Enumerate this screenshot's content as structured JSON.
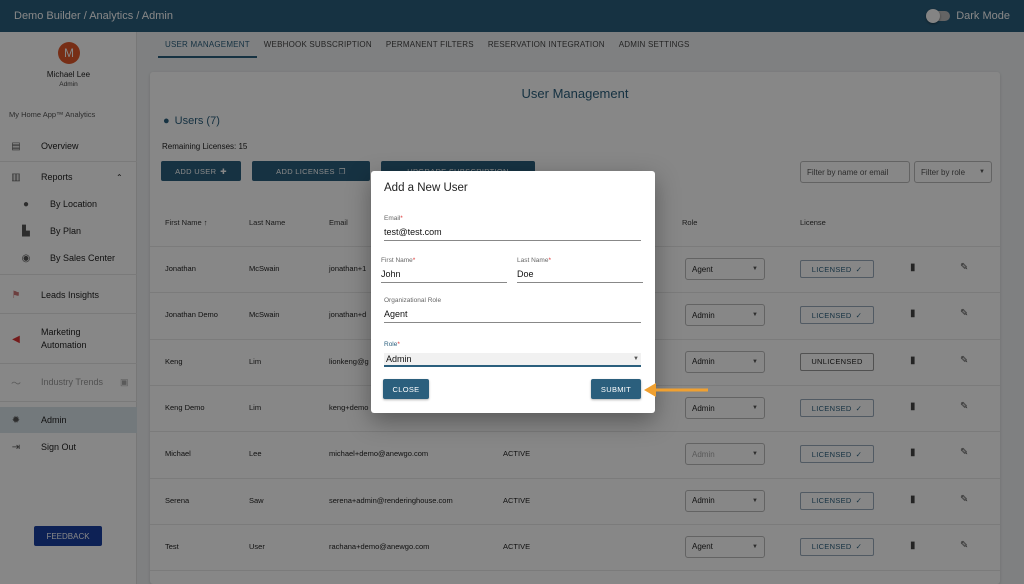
{
  "topbar": {
    "breadcrumb": "Demo Builder  /  Analytics / Admin",
    "dark_mode_label": "Dark Mode"
  },
  "user": {
    "avatar_initial": "M",
    "name": "Michael Lee",
    "role": "Admin"
  },
  "sidebar": {
    "app_name": "My Home App™ Analytics",
    "items": [
      {
        "label": "Overview",
        "icon": "clipboard-icon"
      },
      {
        "label": "Reports",
        "icon": "bar-chart-icon"
      },
      {
        "label": "By Location",
        "icon": "location-pin-icon"
      },
      {
        "label": "By Plan",
        "icon": "building-icon"
      },
      {
        "label": "By Sales Center",
        "icon": "compass-icon"
      },
      {
        "label": "Leads Insights",
        "icon": "chart-people-icon"
      },
      {
        "label": "Marketing\nAutomation",
        "icon": "megaphone-icon"
      },
      {
        "label": "Industry Trends",
        "icon": "trend-icon"
      },
      {
        "label": "Admin",
        "icon": "gear-icon"
      },
      {
        "label": "Sign Out",
        "icon": "exit-icon"
      }
    ],
    "feedback_label": "FEEDBACK"
  },
  "tabs": [
    "USER MANAGEMENT",
    "WEBHOOK SUBSCRIPTION",
    "PERMANENT FILTERS",
    "RESERVATION INTEGRATION",
    "ADMIN SETTINGS"
  ],
  "main": {
    "title": "User Management",
    "users_heading": "Users (7)",
    "remaining": "Remaining Licenses: 15",
    "add_user": "ADD USER",
    "add_licenses": "ADD LICENSES",
    "upgrade": "UPGRADE SUBSCRIPTION",
    "filter_placeholder": "Filter by name or email",
    "filter_role": "Filter by role",
    "columns": [
      "First Name",
      "Last Name",
      "Email",
      "Role",
      "License"
    ],
    "rows": [
      {
        "first": "Jonathan",
        "last": "McSwain",
        "email": "jonathan+1",
        "status": "",
        "role": "Agent",
        "license": "LICENSED"
      },
      {
        "first": "Jonathan Demo",
        "last": "McSwain",
        "email": "jonathan+d",
        "status": "",
        "role": "Admin",
        "license": "LICENSED"
      },
      {
        "first": "Keng",
        "last": "Lim",
        "email": "lionkeng@g",
        "status": "",
        "role": "Admin",
        "license": "UNLICENSED"
      },
      {
        "first": "Keng Demo",
        "last": "Lim",
        "email": "keng+demo",
        "status": "",
        "role": "Admin",
        "license": "LICENSED"
      },
      {
        "first": "Michael",
        "last": "Lee",
        "email": "michael+demo@anewgo.com",
        "status": "ACTIVE",
        "role": "Admin",
        "license": "LICENSED"
      },
      {
        "first": "Serena",
        "last": "Saw",
        "email": "serena+admin@renderinghouse.com",
        "status": "ACTIVE",
        "role": "Admin",
        "license": "LICENSED"
      },
      {
        "first": "Test",
        "last": "User",
        "email": "rachana+demo@anewgo.com",
        "status": "ACTIVE",
        "role": "Agent",
        "license": "LICENSED"
      }
    ]
  },
  "dialog": {
    "title": "Add a New User",
    "email_label": "Email",
    "email_value": "test@test.com",
    "first_label": "First Name",
    "first_value": "John",
    "last_label": "Last Name",
    "last_value": "Doe",
    "org_label": "Organizational Role",
    "org_value": "Agent",
    "role_label": "Role",
    "role_value": "Admin",
    "close": "CLOSE",
    "submit": "SUBMIT"
  },
  "colors": {
    "primary": "#2b5f7d",
    "callout": "#f0a030",
    "feedback": "#1a3fa0"
  }
}
